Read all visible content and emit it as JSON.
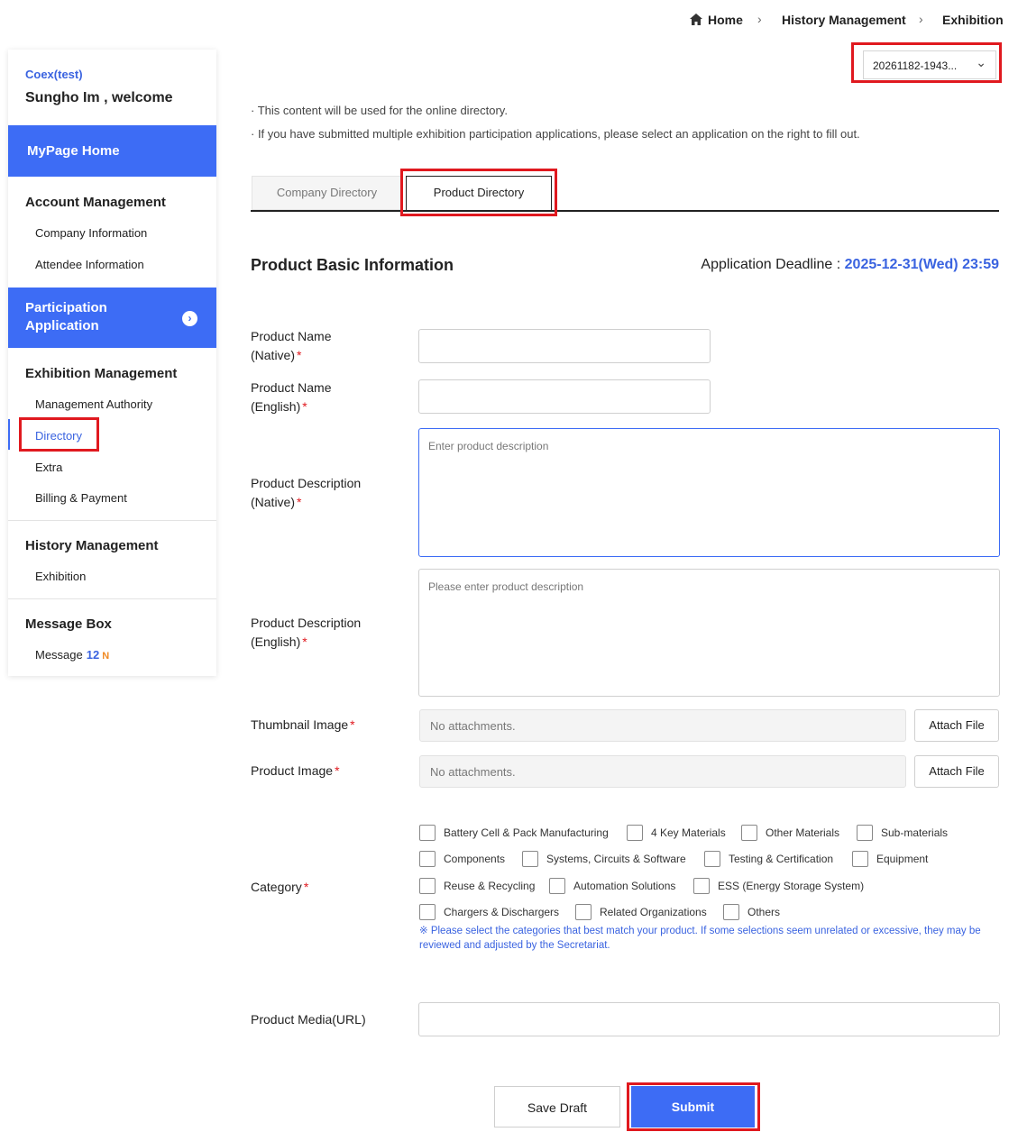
{
  "breadcrumb": {
    "home": "Home",
    "level1": "History Management",
    "level2": "Exhibition"
  },
  "application_select": {
    "value": "20261182-1943..."
  },
  "sidebar": {
    "org": "Coex(test)",
    "welcome": "Sungho Im , welcome",
    "mypage_home": "MyPage Home",
    "account_management": "Account Management",
    "company_information": "Company Information",
    "attendee_information": "Attendee Information",
    "participation_application": "Participation Application",
    "exhibition_management": "Exhibition Management",
    "management_authority": "Management Authority",
    "directory": "Directory",
    "extra": "Extra",
    "billing_payment": "Billing & Payment",
    "history_management": "History Management",
    "exhibition": "Exhibition",
    "message_box": "Message Box",
    "message": "Message",
    "message_count": "12",
    "message_new": "N"
  },
  "notices": [
    "· This content will be used for the online directory.",
    "· If you have submitted multiple exhibition participation applications, please select an application on the right to fill out."
  ],
  "tabs": {
    "company": "Company Directory",
    "product": "Product Directory"
  },
  "section_title": "Product Basic Information",
  "deadline": {
    "label": "Application Deadline : ",
    "value": "2025-12-31(Wed) 23:59"
  },
  "form": {
    "product_name_native": {
      "line1": "Product Name",
      "line2": "(Native)",
      "value": ""
    },
    "product_name_english": {
      "line1": "Product Name",
      "line2": "(English)",
      "value": ""
    },
    "product_desc_native": {
      "line1": "Product Description",
      "line2": "(Native)",
      "placeholder": "Enter product description"
    },
    "product_desc_english": {
      "line1": "Product Description",
      "line2": "(English)",
      "placeholder": "Please enter product description"
    },
    "thumbnail_image": {
      "label": "Thumbnail Image",
      "status": "No attachments.",
      "button": "Attach File"
    },
    "product_image": {
      "label": "Product Image",
      "status": "No attachments.",
      "button": "Attach File"
    },
    "category": {
      "label": "Category",
      "options": [
        "Battery Cell & Pack Manufacturing",
        "4 Key Materials",
        "Other Materials",
        "Sub-materials",
        "Components",
        "Systems, Circuits & Software",
        "Testing & Certification",
        "Equipment",
        "Reuse & Recycling",
        "Automation Solutions",
        "ESS (Energy Storage System)",
        "Chargers & Dischargers",
        "Related Organizations",
        "Others"
      ],
      "note": "※ Please select the categories that best match your product. If some selections seem unrelated or excessive, they may be reviewed and adjusted by the Secretariat."
    },
    "product_media": {
      "label": "Product Media(URL)",
      "value": ""
    }
  },
  "required_mark": "*",
  "buttons": {
    "save_draft": "Save Draft",
    "submit": "Submit"
  },
  "colors": {
    "accent": "#3d6cf5",
    "highlight_box": "#e0191f",
    "required": "#e0191f",
    "new_badge": "#f08a24"
  }
}
